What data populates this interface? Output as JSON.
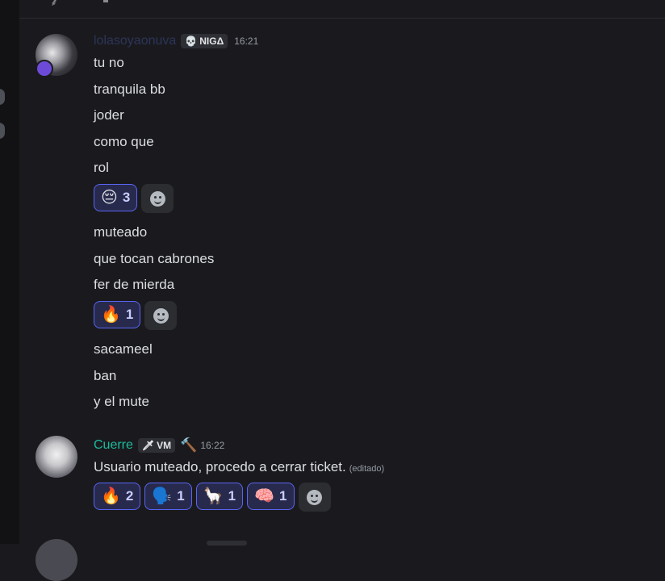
{
  "colors": {
    "bg": "#1a1a1e",
    "accent": "#5865f2",
    "cuerre_name": "#1abc9c",
    "first_name": "#2c3559"
  },
  "msg1": {
    "username": "lolasoyaonuva",
    "tag": {
      "icon": "skull-icon",
      "label": "NIGΔ"
    },
    "time": "16:21",
    "lines_a": [
      "tu no",
      "tranquila bb",
      "joder",
      "como que",
      "rol"
    ],
    "reaction_a": {
      "emoji": "😔",
      "count": "3"
    },
    "lines_b": [
      "muteado",
      "que tocan cabrones",
      "fer de mierda"
    ],
    "reaction_b": {
      "emoji": "🔥",
      "count": "1"
    },
    "lines_c": [
      "sacameel",
      "ban",
      "y el mute"
    ]
  },
  "msg2": {
    "username": "Cuerre",
    "tag": {
      "icon": "sword-icon",
      "label": "VM"
    },
    "badge_icon": "hammer-icon",
    "time": "16:22",
    "text": "Usuario muteado, procedo a cerrar ticket.",
    "edited": "(editado)",
    "reactions": [
      {
        "emoji": "🔥",
        "count": "2"
      },
      {
        "emoji": "🗣️",
        "count": "1"
      },
      {
        "emoji": "🦙",
        "count": "1"
      },
      {
        "emoji": "🧠",
        "count": "1"
      }
    ]
  }
}
